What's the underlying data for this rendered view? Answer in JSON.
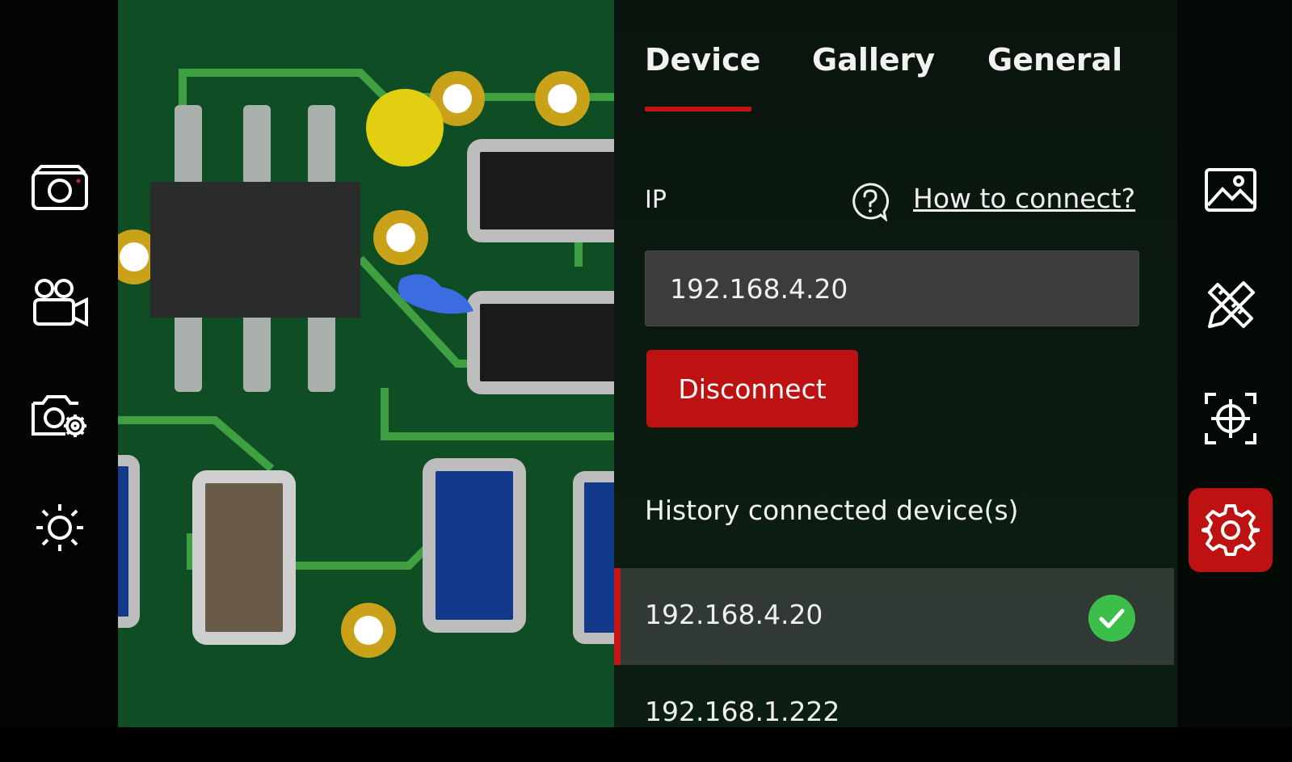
{
  "left_toolbar": {
    "items": [
      {
        "icon": "camera-icon"
      },
      {
        "icon": "video-camera-icon"
      },
      {
        "icon": "camera-settings-icon"
      },
      {
        "icon": "brightness-icon"
      }
    ]
  },
  "settings": {
    "tabs": [
      {
        "label": "Device",
        "active": true
      },
      {
        "label": "Gallery",
        "active": false
      },
      {
        "label": "General",
        "active": false
      }
    ],
    "ip_label": "IP",
    "help_link": "How to connect?",
    "ip_value": "192.168.4.20",
    "disconnect_label": "Disconnect",
    "history_title": "History connected device(s)",
    "history": [
      {
        "ip": "192.168.4.20",
        "connected": true
      },
      {
        "ip": "192.168.1.222",
        "connected": false
      }
    ]
  },
  "right_toolbar": {
    "items": [
      {
        "icon": "gallery-icon"
      },
      {
        "icon": "measure-tools-icon"
      },
      {
        "icon": "crosshair-icon"
      },
      {
        "icon": "settings-gear-icon",
        "active": true
      }
    ]
  },
  "colors": {
    "accent": "#be1212",
    "success": "#3cbf4a",
    "input_bg": "#3b3c3b"
  }
}
